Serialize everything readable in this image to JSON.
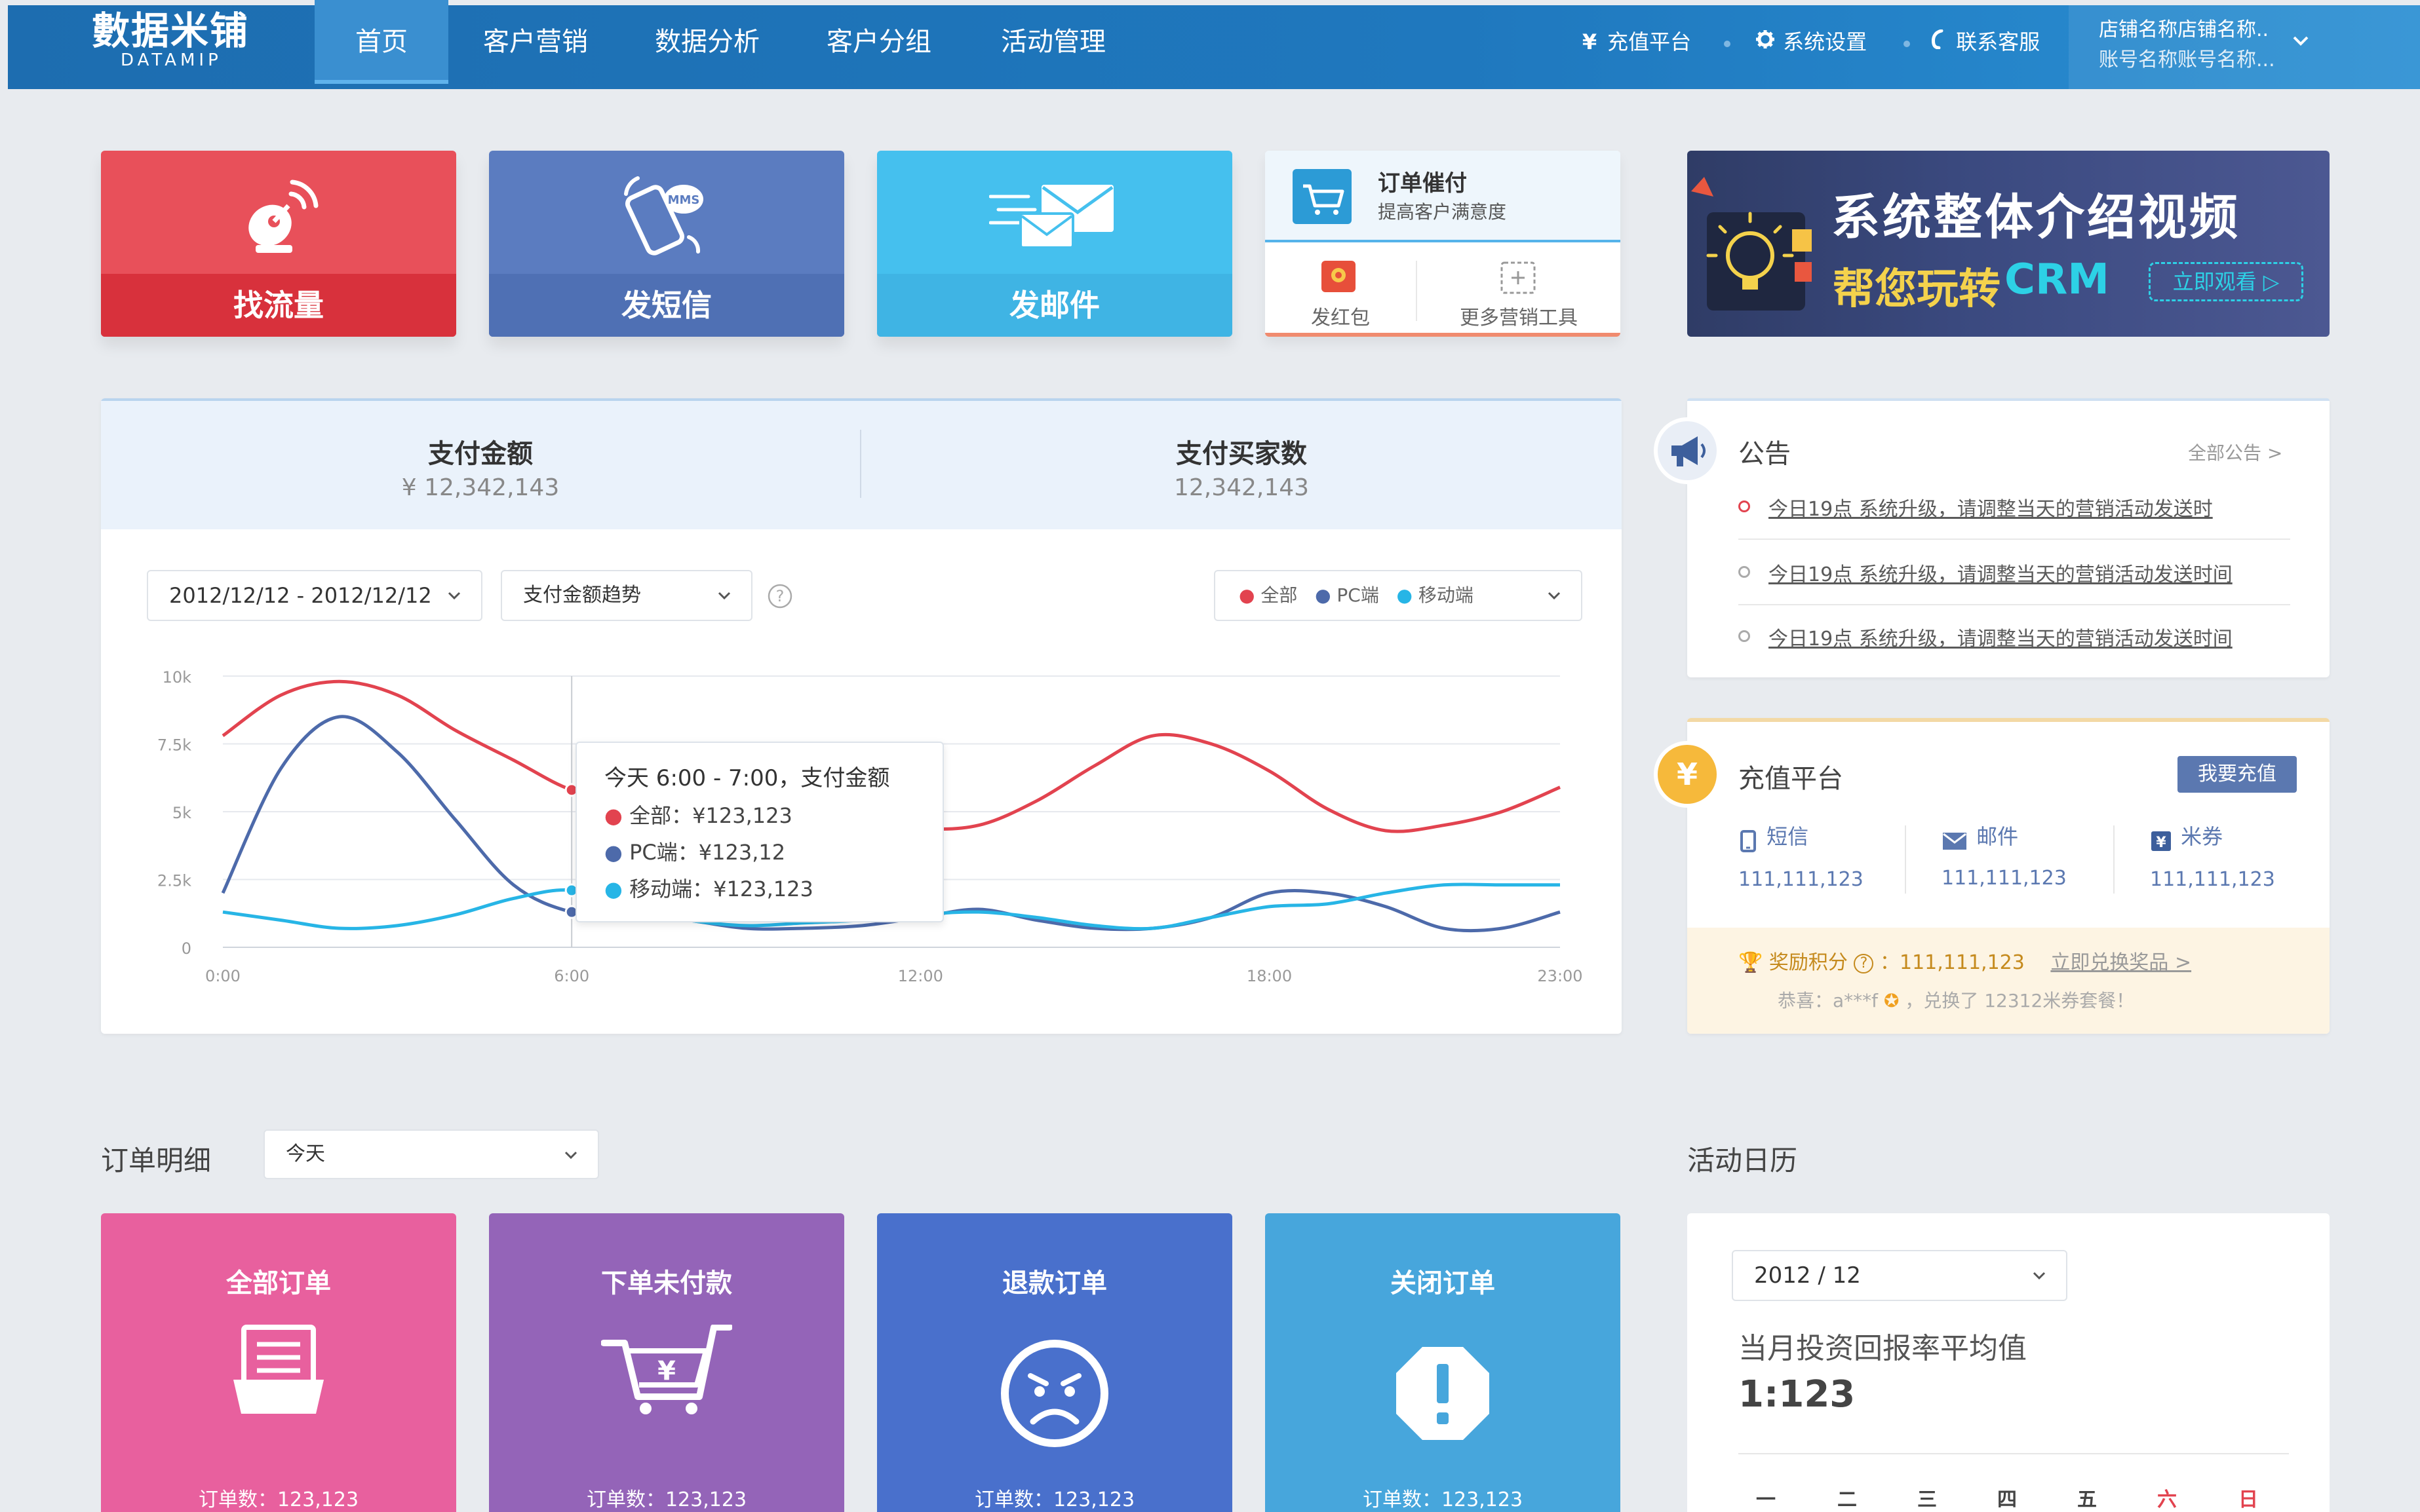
{
  "brand": {
    "name_cn": "數据米铺",
    "name_en": "DATAMIP"
  },
  "nav": {
    "items": [
      {
        "label": "首页",
        "active": true
      },
      {
        "label": "客户营销",
        "active": false
      },
      {
        "label": "数据分析",
        "active": false
      },
      {
        "label": "客户分组",
        "active": false
      },
      {
        "label": "活动管理",
        "active": false
      }
    ],
    "utilities": [
      {
        "label": "充值平台",
        "icon": "yen-icon"
      },
      {
        "label": "系统设置",
        "icon": "gear-icon"
      },
      {
        "label": "联系客服",
        "icon": "phone-icon"
      }
    ],
    "shop_name": "店铺名称店铺名称..",
    "account_name": "账号名称账号名称..."
  },
  "tiles": [
    {
      "label": "找流量",
      "icon": "satellite-icon",
      "color": "#e8505a"
    },
    {
      "label": "发短信",
      "icon": "mms-phone-icon",
      "color": "#4f70b4"
    },
    {
      "label": "发邮件",
      "icon": "envelope-icon",
      "color": "#3fb4e4"
    }
  ],
  "order_reminder": {
    "title": "订单催付",
    "subtitle": "提高客户满意度",
    "red_packet": "发红包",
    "more_tools": "更多营销工具"
  },
  "promo": {
    "title": "系统整体介绍视频",
    "subtitle_cn": "帮您玩转",
    "subtitle_en": "CRM",
    "watch": "立即观看"
  },
  "stats": {
    "pay_amount_label": "支付金额",
    "pay_amount_value": "¥ 12,342,143",
    "buyers_label": "支付买家数",
    "buyers_value": "12,342,143"
  },
  "filters": {
    "date_range": "2012/12/12 - 2012/12/12",
    "metric": "支付金额趋势",
    "legend": [
      "全部",
      "PC端",
      "移动端"
    ]
  },
  "chart_data": {
    "type": "line",
    "x": [
      "0:00",
      "1:00",
      "2:00",
      "3:00",
      "4:00",
      "5:00",
      "6:00",
      "7:00",
      "8:00",
      "9:00",
      "10:00",
      "11:00",
      "12:00",
      "13:00",
      "14:00",
      "15:00",
      "16:00",
      "17:00",
      "18:00",
      "19:00",
      "20:00",
      "21:00",
      "22:00",
      "23:00"
    ],
    "xticks": [
      "0:00",
      "6:00",
      "12:00",
      "18:00",
      "23:00"
    ],
    "yticks": [
      "0",
      "2.5k",
      "5k",
      "7.5k",
      "10k"
    ],
    "ylim": [
      0,
      10000
    ],
    "series": [
      {
        "name": "全部",
        "color": "#e2434f",
        "values": [
          7800,
          9300,
          9800,
          9300,
          8000,
          6900,
          5800,
          5400,
          5300,
          5200,
          5400,
          4900,
          4400,
          4500,
          5400,
          6700,
          7800,
          7500,
          6500,
          5100,
          4300,
          4500,
          5000,
          5900
        ]
      },
      {
        "name": "PC端",
        "color": "#4d6aaa",
        "values": [
          2000,
          6600,
          8500,
          7200,
          4700,
          2300,
          1300,
          1200,
          1000,
          700,
          700,
          800,
          1100,
          1400,
          1000,
          700,
          700,
          1100,
          2000,
          2000,
          1500,
          700,
          700,
          1300
        ]
      },
      {
        "name": "移动端",
        "color": "#27b5e6",
        "values": [
          1300,
          1000,
          700,
          800,
          1200,
          1800,
          2100,
          1400,
          1000,
          800,
          900,
          1000,
          1200,
          1300,
          1100,
          800,
          700,
          1100,
          1500,
          1600,
          2000,
          2300,
          2300,
          2300
        ]
      }
    ],
    "tooltip": {
      "title": "今天 6:00 - 7:00，支付金额",
      "rows": [
        {
          "name": "全部",
          "value": "¥123,123"
        },
        {
          "name": "PC端",
          "value": "¥123,12"
        },
        {
          "name": "移动端",
          "value": "¥123,123"
        }
      ]
    }
  },
  "notice": {
    "title": "公告",
    "all": "全部公告 >",
    "items": [
      {
        "text": "今日19点 系统升级，请调整当天的营销活动发送时",
        "unread": true
      },
      {
        "text": "今日19点 系统升级，请调整当天的营销活动发送时间",
        "unread": false
      },
      {
        "text": "今日19点 系统升级，请调整当天的营销活动发送时间",
        "unread": false
      }
    ]
  },
  "recharge": {
    "title": "充值平台",
    "button": "我要充值",
    "items": [
      {
        "label": "短信",
        "value": "111,111,123",
        "icon": "phone-icon"
      },
      {
        "label": "邮件",
        "value": "111,111,123",
        "icon": "mail-icon"
      },
      {
        "label": "米券",
        "value": "111,111,123",
        "icon": "yen-box-icon"
      }
    ],
    "reward_label": "奖励积分",
    "reward_value": "：111,111,123",
    "redeem": "立即兑换奖品 >",
    "congrats_prefix": "恭喜：a***f",
    "congrats_suffix": "，兑换了 12312米券套餐！"
  },
  "orders": {
    "title": "订单明细",
    "period": "今天",
    "tiles": [
      {
        "label": "全部订单",
        "count": "订单数：123,123",
        "color": "#e8609e"
      },
      {
        "label": "下单未付款",
        "count": "订单数：123,123",
        "color": "#9464b8"
      },
      {
        "label": "退款订单",
        "count": "订单数：123,123",
        "color": "#4970cc"
      },
      {
        "label": "关闭订单",
        "count": "订单数：123,123",
        "color": "#47a6dc"
      }
    ]
  },
  "calendar": {
    "title": "活动日历",
    "month": "2012 / 12",
    "roi_label": "当月投资回报率平均值",
    "roi_value": "1:123",
    "weekdays": [
      "一",
      "二",
      "三",
      "四",
      "五",
      "六",
      "日"
    ],
    "weekend_color": "#e2434f"
  }
}
